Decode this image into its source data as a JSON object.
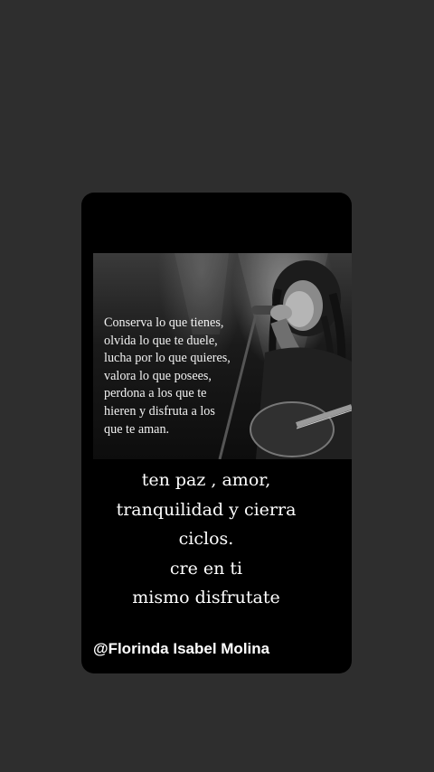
{
  "story": {
    "quote_lines": [
      "Conserva lo que tienes,",
      "olvida lo que te duele,",
      "lucha por lo que quieres,",
      "valora lo que posees,",
      "perdona a los que te",
      "hieren y disfruta a los",
      "que te aman."
    ],
    "caption_lines": [
      "ten paz , amor,",
      "tranquilidad y cierra",
      "ciclos.",
      "cre en ti",
      "mismo disfrutate"
    ],
    "handle": "@Florinda Isabel Molina"
  },
  "colors": {
    "background": "#2e2e2e",
    "card": "#000000",
    "text": "#ffffff"
  }
}
